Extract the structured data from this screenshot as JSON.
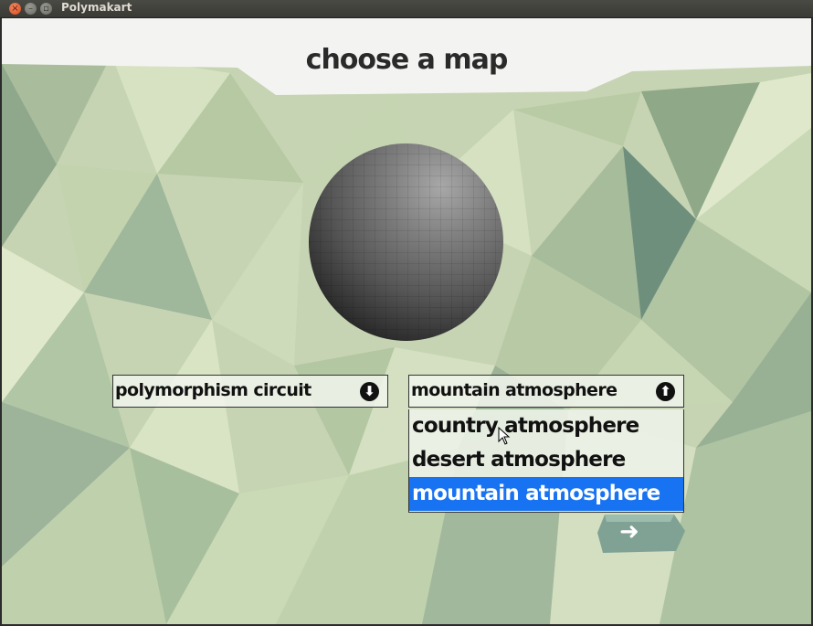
{
  "window": {
    "title": "Polymakart",
    "close_glyph": "×",
    "minimize_glyph": "–",
    "maximize_glyph": "▫"
  },
  "screen": {
    "title": "choose a map"
  },
  "map_select": {
    "value": "polymorphism circuit",
    "arrow_glyph": "⬇",
    "icon": "arrow-down-circle-icon"
  },
  "atmosphere_select": {
    "value": "mountain atmosphere",
    "arrow_glyph": "⬆",
    "icon": "arrow-up-circle-icon",
    "options": [
      "country atmosphere",
      "desert atmosphere",
      "mountain atmosphere"
    ],
    "selected_index": 2
  },
  "next_button": {
    "glyph": "➜",
    "icon": "arrow-right-icon"
  },
  "colors": {
    "highlight": "#1873f2",
    "background": "#c9d6b7",
    "next_button": "#7fa294"
  }
}
